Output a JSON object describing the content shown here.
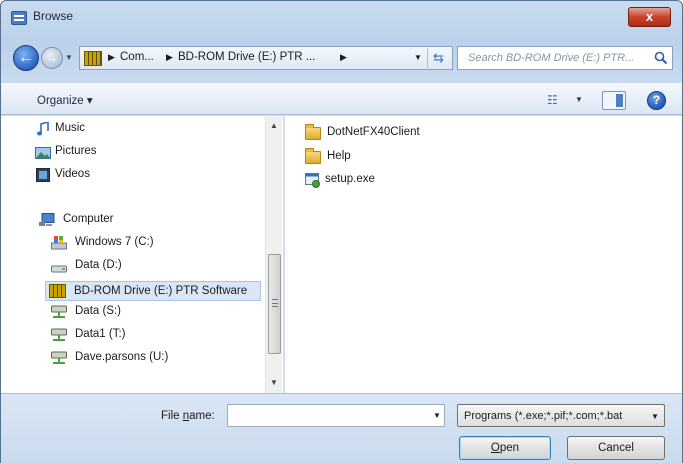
{
  "window": {
    "title": "Browse",
    "close_label": "x"
  },
  "nav": {
    "back_glyph": "←",
    "forward_glyph": "→",
    "address_crumbs": [
      "Com...",
      "BD-ROM Drive (E:) PTR ..."
    ],
    "refresh_glyph": "⇆",
    "search_placeholder": "Search BD-ROM Drive (E:) PTR..."
  },
  "toolbar": {
    "organize_label": "Organize ▾",
    "views_dd": "▼",
    "help_label": "?"
  },
  "nav_pane": {
    "items": [
      {
        "label": "Music",
        "icon": "music-icon"
      },
      {
        "label": "Pictures",
        "icon": "pictures-icon"
      },
      {
        "label": "Videos",
        "icon": "videos-icon"
      },
      {
        "label": "Computer",
        "icon": "computer-icon"
      },
      {
        "label": "Windows 7 (C:)",
        "icon": "windows-drive-icon"
      },
      {
        "label": "Data (D:)",
        "icon": "hard-drive-icon"
      },
      {
        "label": "BD-ROM Drive (E:) PTR Software",
        "icon": "bd-rom-drive-icon",
        "selected": true
      },
      {
        "label": "Data (S:)",
        "icon": "network-drive-icon"
      },
      {
        "label": "Data1 (T:)",
        "icon": "network-drive-icon"
      },
      {
        "label": "Dave.parsons (U:)",
        "icon": "network-drive-icon"
      }
    ]
  },
  "file_list": {
    "items": [
      {
        "label": "DotNetFX40Client",
        "icon": "folder-icon"
      },
      {
        "label": "Help",
        "icon": "folder-icon"
      },
      {
        "label": "setup.exe",
        "icon": "exe-icon"
      }
    ]
  },
  "bottom": {
    "file_name_label_prefix": "File ",
    "file_name_label_access": "n",
    "file_name_label_suffix": "ame:",
    "file_name_value": "",
    "file_type_selected": "Programs (*.exe;*.pif;*.com;*.bat",
    "open_label_access": "O",
    "open_label_rest": "pen",
    "cancel_label": "Cancel"
  },
  "colors": {
    "accent": "#2a64c4",
    "selection": "#d9e6f6",
    "close": "#c8452c"
  }
}
